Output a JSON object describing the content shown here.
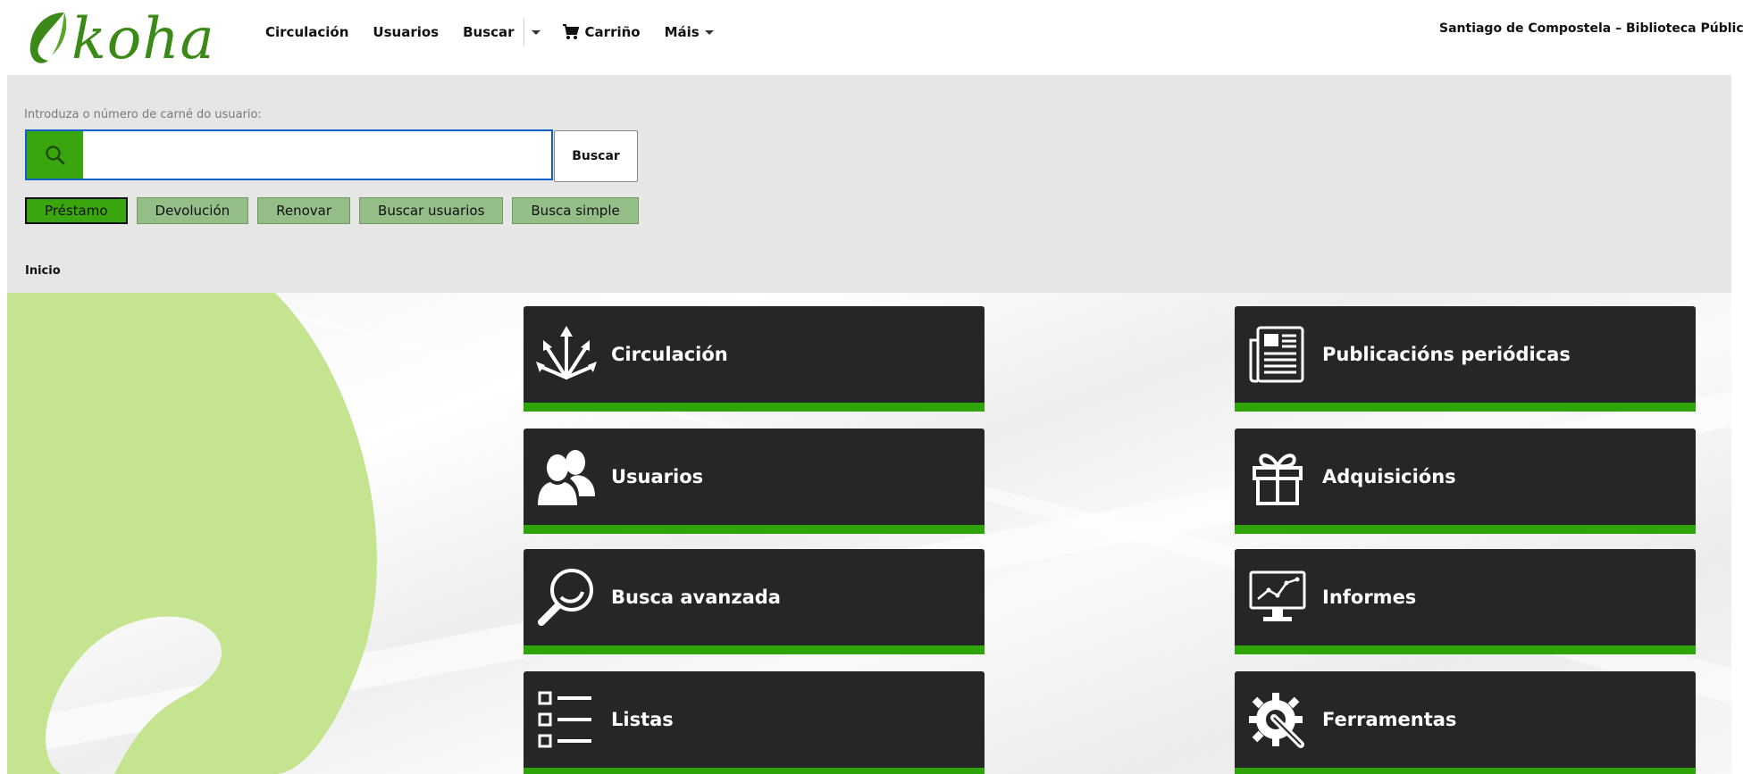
{
  "brand": {
    "logo_text": "koha"
  },
  "nav": {
    "items": [
      {
        "label": "Circulación"
      },
      {
        "label": "Usuarios"
      }
    ],
    "search_label": "Buscar",
    "cart_label": "Carriño",
    "more_label": "Máis"
  },
  "library_name": "Santiago de Compostela – Biblioteca Públic",
  "search": {
    "label": "Introduza o número de carné do usuario:",
    "value": "",
    "submit_label": "Buscar",
    "tabs": [
      {
        "label": "Préstamo",
        "active": true
      },
      {
        "label": "Devolución",
        "active": false
      },
      {
        "label": "Renovar",
        "active": false
      },
      {
        "label": "Buscar usuarios",
        "active": false
      },
      {
        "label": "Busca simple",
        "active": false
      }
    ]
  },
  "breadcrumb": "Inicio",
  "modules": [
    {
      "label": "Circulación",
      "icon": "circulation-arrows-icon"
    },
    {
      "label": "Publicacións periódicas",
      "icon": "newspaper-icon"
    },
    {
      "label": "Usuarios",
      "icon": "users-icon"
    },
    {
      "label": "Adquisicións",
      "icon": "gift-icon"
    },
    {
      "label": "Busca avanzada",
      "icon": "magnifier-icon"
    },
    {
      "label": "Informes",
      "icon": "chart-monitor-icon"
    },
    {
      "label": "Listas",
      "icon": "list-icon"
    },
    {
      "label": "Ferramentas",
      "icon": "gear-wrench-icon"
    }
  ],
  "colors": {
    "accent_green": "#3aa60d",
    "tab_green": "#94bd88",
    "tile_background": "#262626",
    "leaf_green": "#c5e48f"
  }
}
